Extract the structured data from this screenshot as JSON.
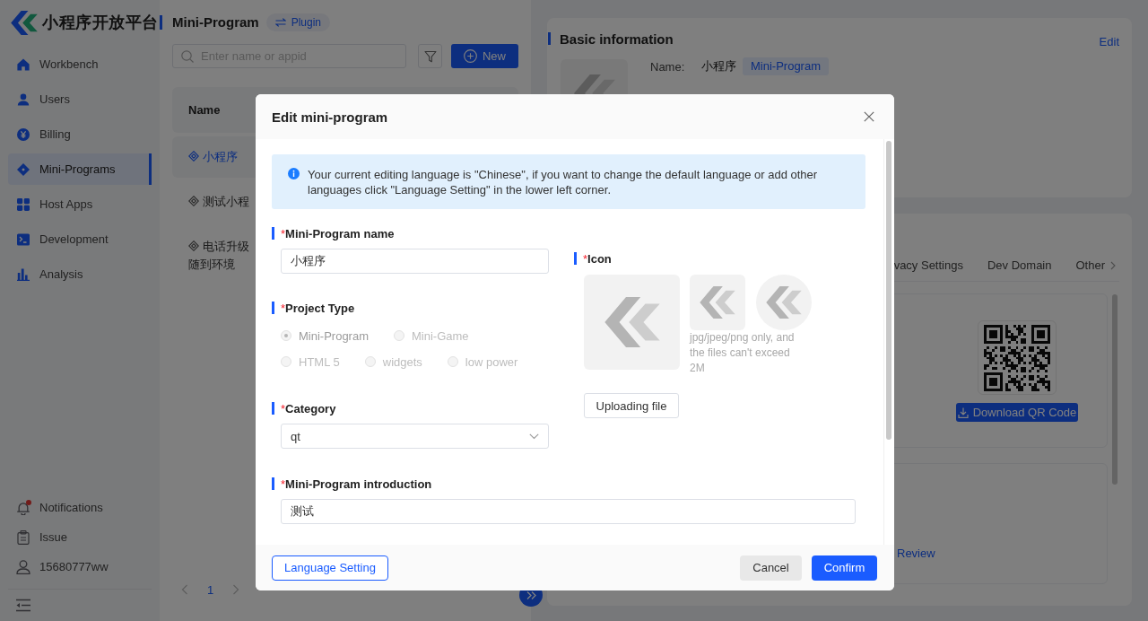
{
  "brand": {
    "name": "小程序开放平台"
  },
  "sidebar": {
    "items": [
      {
        "label": "Workbench",
        "selected": false
      },
      {
        "label": "Users",
        "selected": false
      },
      {
        "label": "Billing",
        "selected": false
      },
      {
        "label": "Mini-Programs",
        "selected": true
      },
      {
        "label": "Host Apps",
        "selected": false
      },
      {
        "label": "Development",
        "selected": false
      },
      {
        "label": "Analysis",
        "selected": false
      }
    ],
    "footer_items": [
      {
        "label": "Notifications",
        "unread": true
      },
      {
        "label": "Issue",
        "unread": false
      },
      {
        "label": "15680777ww",
        "unread": false
      }
    ]
  },
  "list_panel": {
    "title": "Mini-Program",
    "badge": "Plugin",
    "search": {
      "placeholder": "Enter name or appid"
    },
    "new_button": "New",
    "columns": [
      "Name"
    ],
    "rows": [
      {
        "name": "小程序",
        "selected": true
      },
      {
        "name": "测试小程",
        "selected": false
      },
      {
        "name": "电话升级随到环境",
        "selected": false
      }
    ],
    "pagination": {
      "pages": [
        {
          "label": "1",
          "selected": true
        }
      ]
    }
  },
  "basic_info": {
    "title": "Basic information",
    "edit_link": "Edit",
    "fields": [
      {
        "label": "Name:",
        "value": "小程序",
        "tag": "Mini-Program"
      }
    ]
  },
  "details": {
    "tabs": [
      {
        "label": "vacy Settings",
        "selected": false
      },
      {
        "label": "Dev Domain",
        "selected": false
      },
      {
        "label": "Other",
        "selected": false
      }
    ],
    "qr_button": "Download QR Code",
    "review_link": "Review"
  },
  "dialog": {
    "title": "Edit mini-program",
    "notice": "Your current editing language is \"Chinese\", if you want to change the default language or add other languages click \"Language Setting\" in the lower left corner.",
    "name_field": {
      "required_mark": "*",
      "label": "Mini-Program name",
      "value": "小程序"
    },
    "project_type": {
      "required_mark": "*",
      "label": "Project Type",
      "options": [
        {
          "label": "Mini-Program",
          "selected": true,
          "disabled": true
        },
        {
          "label": "Mini-Game",
          "selected": false,
          "disabled": true
        },
        {
          "label": "HTML 5",
          "selected": false,
          "disabled": true
        },
        {
          "label": "widgets",
          "selected": false,
          "disabled": true
        },
        {
          "label": "low power",
          "selected": false,
          "disabled": true
        }
      ]
    },
    "category": {
      "required_mark": "*",
      "label": "Category",
      "value": "qt"
    },
    "icon_upload": {
      "required_mark": "*",
      "label": "Icon",
      "hint": "jpg/jpeg/png only, and the files can't exceed 2M",
      "button": "Uploading file"
    },
    "introduction": {
      "required_mark": "*",
      "label": "Mini-Program introduction",
      "value": "测试"
    },
    "footer": {
      "language_button": "Language Setting",
      "cancel_button": "Cancel",
      "confirm_button": "Confirm"
    }
  }
}
